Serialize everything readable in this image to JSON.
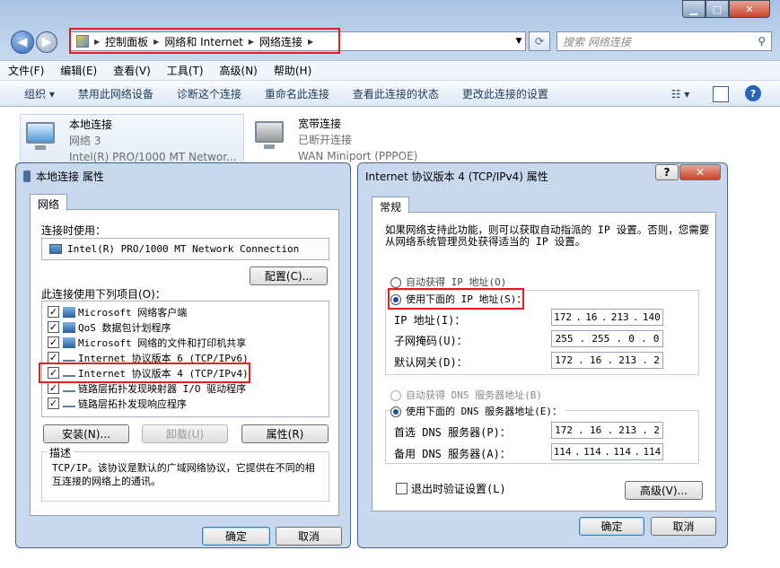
{
  "explorer": {
    "breadcrumb": [
      "控制面板",
      "网络和 Internet",
      "网络连接"
    ],
    "search_placeholder": "搜索 网络连接",
    "menu": [
      "文件(F)",
      "编辑(E)",
      "查看(V)",
      "工具(T)",
      "高级(N)",
      "帮助(H)"
    ],
    "toolbar": [
      "组织 ▾",
      "禁用此网络设备",
      "诊断这个连接",
      "重命名此连接",
      "查看此连接的状态",
      "更改此连接的设置"
    ],
    "connections": [
      {
        "name": "本地连接",
        "status": "网络  3",
        "device": "Intel(R) PRO/1000 MT Networ..."
      },
      {
        "name": "宽带连接",
        "status": "已断开连接",
        "device": "WAN Miniport (PPPOE)"
      }
    ]
  },
  "props_dialog": {
    "title": "本地连接 属性",
    "tab": "网络",
    "connect_using_label": "连接时使用：",
    "adapter": "Intel(R) PRO/1000 MT Network Connection",
    "configure_btn": "配置(C)...",
    "items_label": "此连接使用下列项目(O)：",
    "items": [
      {
        "label": "Microsoft 网络客户端",
        "checked": true
      },
      {
        "label": "QoS 数据包计划程序",
        "checked": true
      },
      {
        "label": "Microsoft 网络的文件和打印机共享",
        "checked": true
      },
      {
        "label": "Internet 协议版本 6 (TCP/IPv6)",
        "checked": true
      },
      {
        "label": "Internet 协议版本 4 (TCP/IPv4)",
        "checked": true
      },
      {
        "label": "链路层拓扑发现映射器 I/O 驱动程序",
        "checked": true
      },
      {
        "label": "链路层拓扑发现响应程序",
        "checked": true
      }
    ],
    "install_btn": "安装(N)...",
    "uninstall_btn": "卸载(U)",
    "properties_btn": "属性(R)",
    "desc_label": "描述",
    "desc_text": "TCP/IP。该协议是默认的广域网络协议，它提供在不同的相互连接的网络上的通讯。",
    "ok_btn": "确定",
    "cancel_btn": "取消"
  },
  "ipv4_dialog": {
    "title": "Internet 协议版本 4 (TCP/IPv4) 属性",
    "help": "?",
    "tab": "常规",
    "intro": "如果网络支持此功能，则可以获取自动指派的 IP 设置。否则，您需要从网络系统管理员处获得适当的 IP 设置。",
    "auto_ip": "自动获得 IP 地址(O)",
    "manual_ip": "使用下面的 IP 地址(S)：",
    "ip_label": "IP 地址(I)：",
    "ip": [
      "172",
      "16",
      "213",
      "140"
    ],
    "mask_label": "子网掩码(U)：",
    "mask": [
      "255",
      "255",
      "0",
      "0"
    ],
    "gateway_label": "默认网关(D)：",
    "gateway": [
      "172",
      "16",
      "213",
      "2"
    ],
    "auto_dns": "自动获得 DNS 服务器地址(B)",
    "manual_dns": "使用下面的 DNS 服务器地址(E)：",
    "dns1_label": "首选 DNS 服务器(P)：",
    "dns1": [
      "172",
      "16",
      "213",
      "2"
    ],
    "dns2_label": "备用 DNS 服务器(A)：",
    "dns2": [
      "114",
      "114",
      "114",
      "114"
    ],
    "validate": "退出时验证设置(L)",
    "advanced_btn": "高级(V)...",
    "ok_btn": "确定",
    "cancel_btn": "取消"
  },
  "colors": {
    "highlight": "#e02020",
    "selected_radio": "#1b4e9b"
  }
}
